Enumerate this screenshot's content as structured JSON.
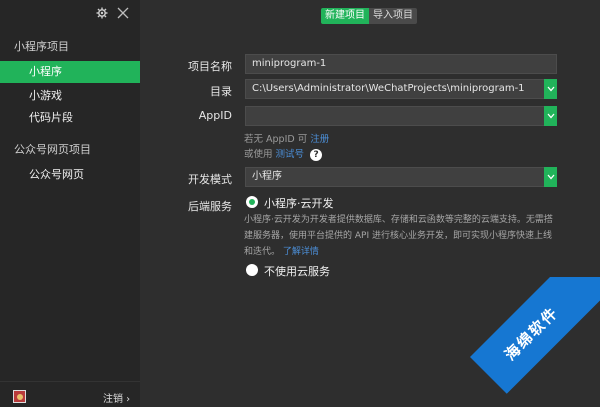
{
  "sidebar": {
    "section1_title": "小程序项目",
    "items1": [
      {
        "label": "小程序"
      },
      {
        "label": "小游戏"
      },
      {
        "label": "代码片段"
      }
    ],
    "section2_title": "公众号网页项目",
    "items2": [
      {
        "label": "公众号网页"
      }
    ],
    "logout_label": "注销 ›"
  },
  "tabs": {
    "new_project": "新建项目",
    "import_project": "导入项目"
  },
  "form": {
    "name_label": "项目名称",
    "name_value": "miniprogram-1",
    "dir_label": "目录",
    "dir_value": "C:\\Users\\Administrator\\WeChatProjects\\miniprogram-1",
    "appid_label": "AppID",
    "appid_value": "",
    "hint_no_appid": "若无 AppID 可",
    "hint_register": "注册",
    "hint_or_use": "或使用",
    "hint_test_id": "测试号",
    "mode_label": "开发模式",
    "mode_value": "小程序",
    "backend_label": "后端服务",
    "option_cloud": "小程序·云开发",
    "cloud_desc": "小程序·云开发为开发者提供数据库、存储和云函数等完整的云端支持。无需搭建服务器，使用平台提供的 API 进行核心业务开发，即可实现小程序快速上线和迭代。",
    "learn_more": "了解详情",
    "option_no_cloud": "不使用云服务"
  },
  "watermark": {
    "text": "海绵软件"
  },
  "colors": {
    "accent": "#21b35a",
    "link": "#4c8fd8"
  }
}
